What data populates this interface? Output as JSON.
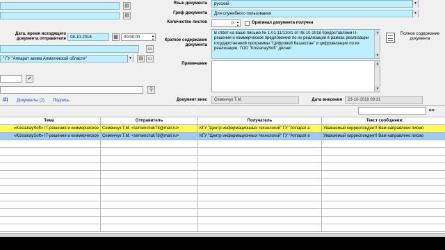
{
  "left": {
    "date_label": "Дата, время исходящего документа отправителя",
    "date_value": "08-10-2018",
    "time_value": "00:00:00",
    "sender_org": "\" ГУ \"Аппарат акима Алматинской области\""
  },
  "right": {
    "language_label": "Язык документа",
    "language_value": "русский",
    "stamp_label": "Гриф документа",
    "stamp_value": "Для служебного пользования",
    "sheets_label": "Количество листов",
    "sheets_value": "0",
    "original_label": "Оригинал документа получен",
    "summary_label": "Краткое содержание документа",
    "summary_text": "В ответ на ваше письмо № 1-01-11/120/1 от 08-10-2018 предоставляем IT-решения и коммерческое предложение по их реализации в рамках реализации государственной программы \"Цифровой Казахстан\" и цифровизации по их реализации. ТОО \"KostanaySoft\" делает",
    "full_content_button": "Полное содержание документа",
    "note_label": "Примечание"
  },
  "tabs": [
    {
      "label": "(2)"
    },
    {
      "label": "Документы (2)"
    },
    {
      "label": "Подпись"
    }
  ],
  "info": {
    "author_label": "Документ внес",
    "author_value": "Семенчук Т.М.",
    "entry_date_label": "Дата внесения",
    "entry_date_value": "23-10-2018 09:31"
  },
  "table": {
    "columns": [
      "Тема",
      "Отправитель",
      "Получатель",
      "Текст сообщения:"
    ],
    "rows": [
      [
        "«KostanaySoft» IT-решения и коммерческое",
        "Семенчук Т.М. <semenchuk78@mail.ru>",
        "КГУ \"Центр информационных технологий\" ГУ \"Аппарат а",
        "Уважаемый корреспондент! Вам направлено писмо"
      ],
      [
        "«KostanaySoft» IT-решения и коммерческое",
        "Семенчук Т.М. <semenchuk78@mail.ru>",
        "КГУ \"Центр информационных технологий\" ГУ \"Аппарат а",
        "Уважаемый корреспондент! Вам направлено писмо"
      ]
    ]
  },
  "colors": {
    "field_bg": "#bfeefc",
    "row_highlight": "#fcfc55",
    "row_selected": "#9ccaf2",
    "tab_text": "#1a3fb0"
  }
}
